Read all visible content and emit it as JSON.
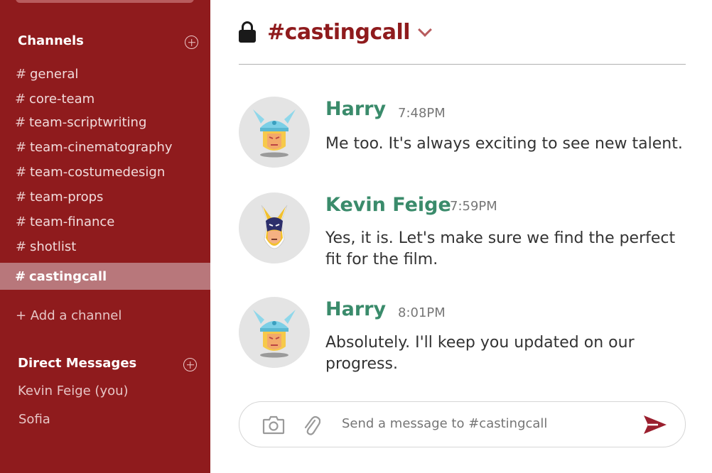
{
  "sidebar": {
    "channels_heading": "Channels",
    "channels": [
      {
        "hash": "#",
        "name": "general"
      },
      {
        "hash": "#",
        "name": "core-team"
      },
      {
        "hash": "#",
        "name": "team-scriptwriting"
      },
      {
        "hash": "#",
        "name": "team-cinematography"
      },
      {
        "hash": "#",
        "name": "team-costumedesign"
      },
      {
        "hash": "#",
        "name": "team-props"
      },
      {
        "hash": "#",
        "name": "team-finance"
      },
      {
        "hash": "#",
        "name": "shotlist"
      },
      {
        "hash": "#",
        "name": "castingcall"
      }
    ],
    "active_channel": "castingcall",
    "add_channel_label": "+ Add a channel",
    "dm_heading": "Direct Messages",
    "direct_messages": [
      "Kevin Feige (you)",
      "Sofia"
    ]
  },
  "header": {
    "title": "#castingcall",
    "lock_icon": "lock-icon",
    "dropdown_icon": "chevron-down-icon"
  },
  "messages": [
    {
      "author": "Harry",
      "time": "7:48PM",
      "text": "Me too. It's always exciting to see new talent.",
      "avatar": "thor-avatar"
    },
    {
      "author": "Kevin Feige",
      "time": "7:59PM",
      "text": "Yes, it is. Let's make sure we find the perfect fit for the film.",
      "avatar": "wolverine-avatar"
    },
    {
      "author": "Harry",
      "time": "8:01PM",
      "text": "Absolutely. I'll keep you updated on our progress.",
      "avatar": "thor-avatar"
    }
  ],
  "composer": {
    "placeholder": "Send a message to #castingcall",
    "camera_icon": "camera-icon",
    "attach_icon": "paperclip-icon",
    "send_icon": "send-icon"
  },
  "colors": {
    "sidebar_bg": "#8f1b1d",
    "active_channel_bg": "#b8777b",
    "author_color": "#3a8b6b",
    "title_color": "#8f1b1d"
  }
}
